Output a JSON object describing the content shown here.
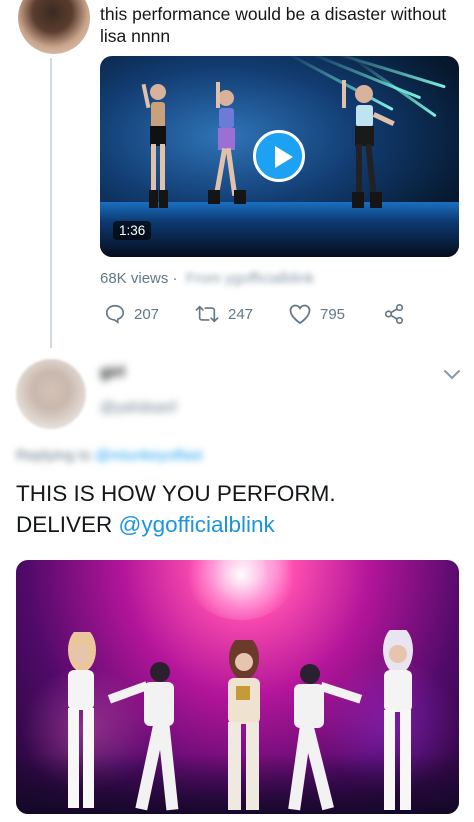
{
  "tweet1": {
    "text": "this performance would be a disaster without lisa nnnn",
    "video": {
      "duration": "1:36"
    },
    "views": "68K views",
    "views_source_blurred": "From ygofficialblink",
    "replies": "207",
    "retweets": "247",
    "likes": "795"
  },
  "tweet2": {
    "display_name_blurred": "girl",
    "handle_blurred": "@yahdsanf",
    "replying_prefix_blurred": "Replying to",
    "replying_handle_blurred": "@miunkeyolfast",
    "text_line1": "THIS IS HOW YOU PERFORM.",
    "text_line2_prefix": "DELIVER ",
    "mention": "@ygofficialblink"
  },
  "colors": {
    "accent": "#1da1f2",
    "mention": "#1b95e0",
    "muted": "#657786",
    "thread_line": "#cfd9de"
  },
  "icons": {
    "reply": "reply-icon",
    "retweet": "retweet-icon",
    "like": "heart-icon",
    "share": "share-icon",
    "more": "chevron-down-icon",
    "play": "play-icon"
  }
}
